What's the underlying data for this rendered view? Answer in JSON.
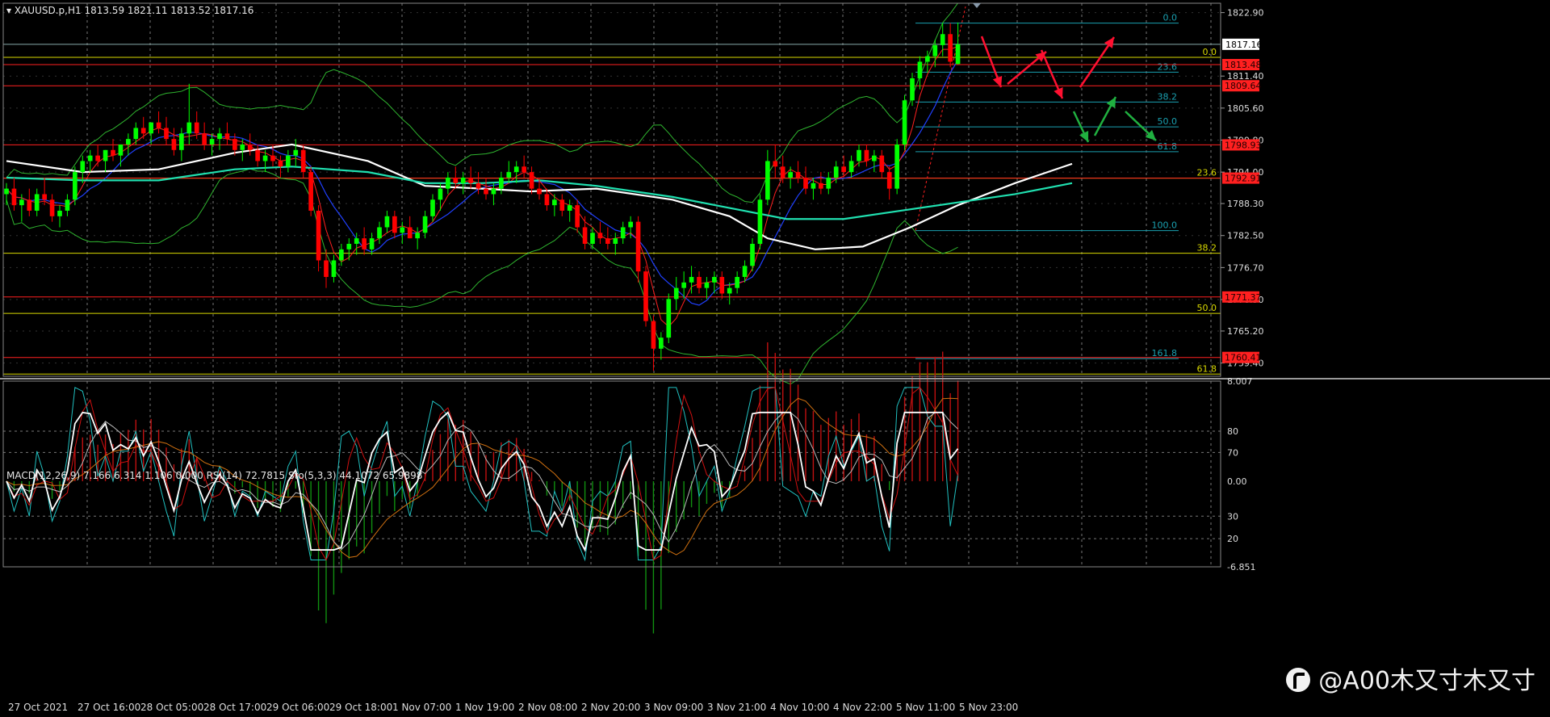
{
  "header": {
    "symbol": "XAUUSD.p,H1",
    "ohlc": "1813.59 1821.11 1813.52 1817.16"
  },
  "sub_header": "MACD(12,26,9) 7.166 6.314 1.106 0.000  RSI(14) 72.7815  Sto(5,3,3) 44.1072 65.9898",
  "watermark": "@A00木又寸木又寸",
  "colors": {
    "bull": "#00ff00",
    "bear": "#ff0000",
    "ma_white": "#ffffff",
    "ma_teal": "#20e0b0",
    "ma_blue": "#2040ff",
    "ma_red": "#ff2020",
    "bands": "#2fb52f",
    "fib_yellow": "#d8d800",
    "fib_teal": "#1aa0b0",
    "arrow_red": "#ff1030",
    "arrow_green": "#20b040"
  },
  "chart_data": [
    {
      "type": "candlestick",
      "symbol": "XAUUSD.p",
      "timeframe": "H1",
      "ylim": [
        1757.0,
        1824.6
      ],
      "y_ticks": [
        "1822.90",
        "1817.16",
        "1811.40",
        "1805.60",
        "1799.80",
        "1794.00",
        "1788.30",
        "1782.50",
        "1776.70",
        "1770.90",
        "1765.20",
        "1759.40"
      ],
      "current_price": "1817.16",
      "x_labels": [
        "27 Oct 2021",
        "27 Oct 16:00",
        "28 Oct 05:00",
        "28 Oct 17:00",
        "29 Oct 06:00",
        "29 Oct 18:00",
        "1 Nov 07:00",
        "1 Nov 19:00",
        "2 Nov 08:00",
        "2 Nov 20:00",
        "3 Nov 09:00",
        "3 Nov 21:00",
        "4 Nov 10:00",
        "4 Nov 22:00",
        "5 Nov 11:00",
        "5 Nov 23:00"
      ],
      "price_levels": [
        {
          "price": "1813.48",
          "color": "#ff2020"
        },
        {
          "price": "1809.64",
          "color": "#ff2020"
        },
        {
          "price": "1798.93",
          "color": "#ff2020"
        },
        {
          "price": "1792.91",
          "color": "#ff2020"
        },
        {
          "price": "1771.37",
          "color": "#ff2020"
        },
        {
          "price": "1760.41",
          "color": "#ff2020"
        }
      ],
      "fib_main": [
        {
          "label": "0.0",
          "price": 1814.8
        },
        {
          "label": "23.6",
          "price": 1792.9
        },
        {
          "label": "38.2",
          "price": 1779.3
        },
        {
          "label": "50.0",
          "price": 1768.4
        },
        {
          "label": "61.8",
          "price": 1757.4
        }
      ],
      "fib_small": [
        {
          "label": "0.0",
          "price": 1821.0
        },
        {
          "label": "23.6",
          "price": 1812.1
        },
        {
          "label": "38.2",
          "price": 1806.7
        },
        {
          "label": "50.0",
          "price": 1802.2
        },
        {
          "label": "61.8",
          "price": 1797.7
        },
        {
          "label": "100.0",
          "price": 1783.4
        },
        {
          "label": "161.8",
          "price": 1760.2
        }
      ],
      "candles": [
        [
          1790,
          1792,
          1788,
          1791
        ],
        [
          1791,
          1793,
          1787,
          1788
        ],
        [
          1788,
          1790,
          1785,
          1789
        ],
        [
          1789,
          1791,
          1786,
          1787
        ],
        [
          1787,
          1791,
          1786,
          1790
        ],
        [
          1790,
          1793,
          1788,
          1789
        ],
        [
          1789,
          1790,
          1785,
          1786
        ],
        [
          1786,
          1788,
          1784,
          1787
        ],
        [
          1787,
          1790,
          1786,
          1789
        ],
        [
          1789,
          1795,
          1788,
          1794
        ],
        [
          1794,
          1797,
          1792,
          1796
        ],
        [
          1796,
          1798,
          1794,
          1797
        ],
        [
          1797,
          1799,
          1795,
          1796
        ],
        [
          1796,
          1798,
          1794,
          1798
        ],
        [
          1798,
          1800,
          1796,
          1797
        ],
        [
          1797,
          1799,
          1795,
          1799
        ],
        [
          1799,
          1801,
          1797,
          1800
        ],
        [
          1800,
          1803,
          1799,
          1802
        ],
        [
          1802,
          1804,
          1800,
          1801
        ],
        [
          1801,
          1803,
          1799,
          1803
        ],
        [
          1803,
          1805,
          1801,
          1802
        ],
        [
          1802,
          1804,
          1799,
          1800
        ],
        [
          1800,
          1802,
          1797,
          1798
        ],
        [
          1798,
          1802,
          1796,
          1801
        ],
        [
          1801,
          1810,
          1799,
          1803
        ],
        [
          1803,
          1805,
          1800,
          1801
        ],
        [
          1801,
          1803,
          1798,
          1799
        ],
        [
          1799,
          1801,
          1797,
          1800
        ],
        [
          1800,
          1802,
          1798,
          1801
        ],
        [
          1801,
          1803,
          1799,
          1800
        ],
        [
          1800,
          1801,
          1797,
          1798
        ],
        [
          1798,
          1800,
          1796,
          1799
        ],
        [
          1799,
          1801,
          1797,
          1798
        ],
        [
          1798,
          1799,
          1795,
          1796
        ],
        [
          1796,
          1798,
          1794,
          1797
        ],
        [
          1797,
          1799,
          1795,
          1796
        ],
        [
          1796,
          1797,
          1793,
          1795
        ],
        [
          1795,
          1798,
          1794,
          1797
        ],
        [
          1797,
          1800,
          1795,
          1798
        ],
        [
          1798,
          1799,
          1793,
          1794
        ],
        [
          1794,
          1795,
          1786,
          1787
        ],
        [
          1787,
          1788,
          1776,
          1778
        ],
        [
          1778,
          1780,
          1773,
          1775
        ],
        [
          1775,
          1779,
          1774,
          1778
        ],
        [
          1778,
          1781,
          1777,
          1780
        ],
        [
          1780,
          1782,
          1778,
          1781
        ],
        [
          1781,
          1783,
          1779,
          1782
        ],
        [
          1782,
          1784,
          1779,
          1780
        ],
        [
          1780,
          1783,
          1779,
          1782
        ],
        [
          1782,
          1785,
          1781,
          1784
        ],
        [
          1784,
          1787,
          1783,
          1786
        ],
        [
          1786,
          1787,
          1782,
          1783
        ],
        [
          1783,
          1785,
          1781,
          1784
        ],
        [
          1784,
          1786,
          1782,
          1782
        ],
        [
          1782,
          1784,
          1780,
          1783
        ],
        [
          1783,
          1787,
          1782,
          1786
        ],
        [
          1786,
          1790,
          1785,
          1789
        ],
        [
          1789,
          1792,
          1787,
          1791
        ],
        [
          1791,
          1794,
          1790,
          1793
        ],
        [
          1793,
          1795,
          1791,
          1792
        ],
        [
          1792,
          1794,
          1790,
          1793
        ],
        [
          1793,
          1795,
          1791,
          1792
        ],
        [
          1792,
          1794,
          1790,
          1791
        ],
        [
          1791,
          1793,
          1789,
          1790
        ],
        [
          1790,
          1792,
          1788,
          1791
        ],
        [
          1791,
          1794,
          1790,
          1793
        ],
        [
          1793,
          1796,
          1792,
          1794
        ],
        [
          1794,
          1796,
          1792,
          1795
        ],
        [
          1795,
          1797,
          1793,
          1794
        ],
        [
          1794,
          1795,
          1790,
          1791
        ],
        [
          1791,
          1793,
          1789,
          1790
        ],
        [
          1790,
          1791,
          1787,
          1788
        ],
        [
          1788,
          1790,
          1786,
          1789
        ],
        [
          1789,
          1790,
          1786,
          1787
        ],
        [
          1787,
          1789,
          1785,
          1788
        ],
        [
          1788,
          1789,
          1783,
          1784
        ],
        [
          1784,
          1786,
          1780,
          1781
        ],
        [
          1781,
          1784,
          1780,
          1783
        ],
        [
          1783,
          1785,
          1781,
          1782
        ],
        [
          1782,
          1784,
          1780,
          1781
        ],
        [
          1781,
          1783,
          1779,
          1782
        ],
        [
          1782,
          1785,
          1781,
          1784
        ],
        [
          1784,
          1786,
          1782,
          1785
        ],
        [
          1785,
          1786,
          1774,
          1776
        ],
        [
          1776,
          1777,
          1766,
          1767
        ],
        [
          1767,
          1768,
          1758,
          1762
        ],
        [
          1762,
          1765,
          1760,
          1764
        ],
        [
          1764,
          1772,
          1763,
          1771
        ],
        [
          1771,
          1775,
          1769,
          1773
        ],
        [
          1773,
          1776,
          1771,
          1774
        ],
        [
          1774,
          1777,
          1772,
          1775
        ],
        [
          1775,
          1776,
          1772,
          1773
        ],
        [
          1773,
          1775,
          1771,
          1774
        ],
        [
          1774,
          1776,
          1772,
          1775
        ],
        [
          1775,
          1776,
          1771,
          1772
        ],
        [
          1772,
          1774,
          1770,
          1773
        ],
        [
          1773,
          1776,
          1772,
          1775
        ],
        [
          1775,
          1778,
          1774,
          1777
        ],
        [
          1777,
          1782,
          1776,
          1781
        ],
        [
          1781,
          1790,
          1780,
          1789
        ],
        [
          1789,
          1798,
          1788,
          1796
        ],
        [
          1796,
          1799,
          1793,
          1795
        ],
        [
          1795,
          1797,
          1792,
          1793
        ],
        [
          1793,
          1795,
          1791,
          1794
        ],
        [
          1794,
          1796,
          1792,
          1793
        ],
        [
          1793,
          1795,
          1790,
          1791
        ],
        [
          1791,
          1793,
          1789,
          1792
        ],
        [
          1792,
          1794,
          1790,
          1791
        ],
        [
          1791,
          1794,
          1790,
          1793
        ],
        [
          1793,
          1796,
          1792,
          1795
        ],
        [
          1795,
          1797,
          1793,
          1794
        ],
        [
          1794,
          1797,
          1793,
          1796
        ],
        [
          1796,
          1799,
          1795,
          1798
        ],
        [
          1798,
          1799,
          1795,
          1796
        ],
        [
          1796,
          1798,
          1794,
          1797
        ],
        [
          1797,
          1798,
          1793,
          1794
        ],
        [
          1794,
          1795,
          1789,
          1791
        ],
        [
          1791,
          1800,
          1790,
          1799
        ],
        [
          1799,
          1808,
          1798,
          1807
        ],
        [
          1807,
          1812,
          1806,
          1811
        ],
        [
          1811,
          1815,
          1809,
          1814
        ],
        [
          1814,
          1816,
          1812,
          1815
        ],
        [
          1815,
          1818,
          1813,
          1817
        ],
        [
          1817,
          1821,
          1815,
          1819
        ],
        [
          1819,
          1821,
          1813,
          1814
        ],
        [
          1813.59,
          1821.11,
          1813.52,
          1817.16
        ]
      ],
      "ma_white": [
        [
          0,
          1796
        ],
        [
          0.08,
          1794
        ],
        [
          0.16,
          1794.5
        ],
        [
          0.24,
          1797.5
        ],
        [
          0.3,
          1799
        ],
        [
          0.38,
          1796
        ],
        [
          0.44,
          1791.5
        ],
        [
          0.5,
          1791
        ],
        [
          0.55,
          1790.5
        ],
        [
          0.62,
          1791
        ],
        [
          0.7,
          1789
        ],
        [
          0.76,
          1786
        ],
        [
          0.8,
          1782
        ],
        [
          0.85,
          1780
        ],
        [
          0.9,
          1780.5
        ],
        [
          0.95,
          1784
        ],
        [
          1.0,
          1788
        ],
        [
          1.06,
          1792
        ],
        [
          1.12,
          1795.5
        ]
      ],
      "ma_teal": [
        [
          0,
          1793
        ],
        [
          0.08,
          1792.5
        ],
        [
          0.16,
          1792.5
        ],
        [
          0.24,
          1794.5
        ],
        [
          0.3,
          1795
        ],
        [
          0.38,
          1794
        ],
        [
          0.44,
          1792
        ],
        [
          0.5,
          1792
        ],
        [
          0.56,
          1792.5
        ],
        [
          0.62,
          1791.5
        ],
        [
          0.7,
          1789.5
        ],
        [
          0.76,
          1787.5
        ],
        [
          0.82,
          1785.5
        ],
        [
          0.88,
          1785.5
        ],
        [
          0.94,
          1787
        ],
        [
          1.0,
          1788.5
        ],
        [
          1.06,
          1790
        ],
        [
          1.12,
          1792
        ]
      ]
    },
    {
      "type": "oscillator",
      "indicators": [
        "MACD(12,26,9)",
        "RSI(14)",
        "Sto(5,3,3)"
      ],
      "values": {
        "macd": [
          7.166,
          6.314,
          1.106,
          0.0
        ],
        "rsi": 72.7815,
        "sto": [
          44.1072,
          65.9898
        ]
      },
      "y_ticks": [
        "8.007",
        "80",
        "70",
        "0.00",
        "30",
        "20",
        "-6.851"
      ]
    }
  ]
}
